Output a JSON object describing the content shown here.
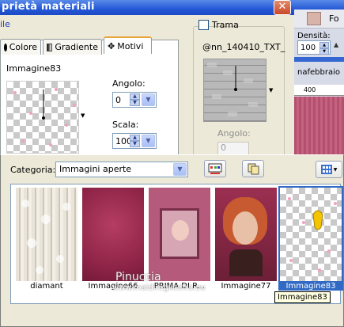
{
  "window": {
    "title": "prietà materiali",
    "menu_label": "ile"
  },
  "right_panel": {
    "top_label": "Fo",
    "density_label": "Densità:",
    "density_value": "100",
    "file_label": "nafebbraio",
    "ruler_label": "400"
  },
  "left_tabs": [
    {
      "label": "Colore",
      "icon": "radio-filled-icon"
    },
    {
      "label": "Gradiente",
      "icon": "gradient-icon"
    },
    {
      "label": "Motivi",
      "icon": "pattern-icon",
      "active": true
    }
  ],
  "pattern_name": "Immagine83",
  "angle": {
    "label": "Angolo:",
    "value": "0"
  },
  "scale": {
    "label": "Scala:",
    "value": "100"
  },
  "texture": {
    "checkbox_label": "Trama",
    "name": "@nn_140410_TXT_",
    "angle_label": "Angolo:",
    "angle_value": "0"
  },
  "category": {
    "label": "Categoria:",
    "selected": "Immagini aperte"
  },
  "gallery": [
    {
      "label": "diamant",
      "kind": "lace"
    },
    {
      "label": "Immagine66",
      "kind": "crimson"
    },
    {
      "label": "PRIMA DI R...",
      "kind": "frame"
    },
    {
      "label": "Immagine77",
      "kind": "woman"
    },
    {
      "label": "Immagine83",
      "kind": "checker",
      "selected": true
    }
  ],
  "tooltip": "Immagine83",
  "watermark": {
    "line1": "Pinuccia",
    "line2": "www.maidireglicefra.eu"
  },
  "colors": {
    "accent": "#316ac5",
    "titlebar": "#2458d6",
    "crimson": "#9c2f52",
    "pink": "#f2a0c0"
  }
}
